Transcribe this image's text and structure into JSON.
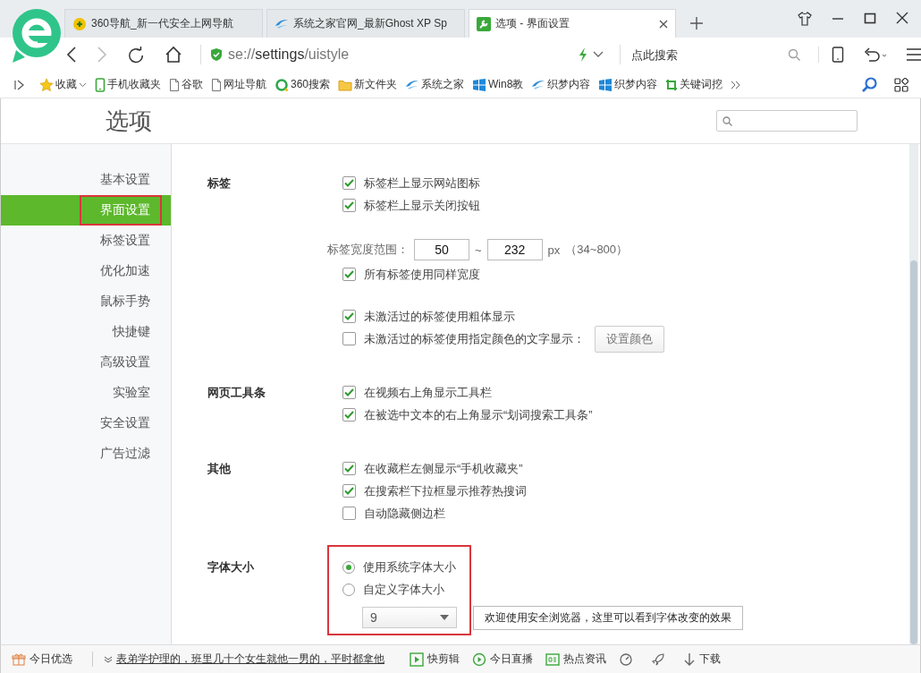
{
  "tabs": [
    {
      "label": "360导航_新一代安全上网导航",
      "kind": "badge",
      "selected": false
    },
    {
      "label": "系统之家官网_最新Ghost XP Sp",
      "kind": "site",
      "selected": false
    },
    {
      "label": "选项 - 界面设置",
      "kind": "wrench",
      "selected": true
    }
  ],
  "address": {
    "url": "se://**settings**/uistyle"
  },
  "search": {
    "placeholder": "点此搜索"
  },
  "bookmarks": [
    {
      "label": "收藏",
      "kind": "star"
    },
    {
      "label": "手机收藏夹",
      "kind": "phone"
    },
    {
      "label": "谷歌",
      "kind": "page"
    },
    {
      "label": "网址导航",
      "kind": "page"
    },
    {
      "label": "360搜索",
      "kind": "ring"
    },
    {
      "label": "新文件夹",
      "kind": "folder"
    },
    {
      "label": "系统之家",
      "kind": "site"
    },
    {
      "label": "Win8教",
      "kind": "windows"
    },
    {
      "label": "织梦内容",
      "kind": "site"
    },
    {
      "label": "织梦内容",
      "kind": "windows"
    },
    {
      "label": "关键词挖",
      "kind": "crop"
    }
  ],
  "page_title": "选项",
  "sidebar": {
    "items": [
      {
        "label": "基本设置",
        "selected": false,
        "highlighted": false
      },
      {
        "label": "界面设置",
        "selected": true,
        "highlighted": true
      },
      {
        "label": "标签设置",
        "selected": false,
        "highlighted": false
      },
      {
        "label": "优化加速",
        "selected": false,
        "highlighted": false
      },
      {
        "label": "鼠标手势",
        "selected": false,
        "highlighted": false
      },
      {
        "label": "快捷键",
        "selected": false,
        "highlighted": false
      },
      {
        "label": "高级设置",
        "selected": false,
        "highlighted": false
      },
      {
        "label": "实验室",
        "selected": false,
        "highlighted": false
      },
      {
        "label": "安全设置",
        "selected": false,
        "highlighted": false
      },
      {
        "label": "广告过滤",
        "selected": false,
        "highlighted": false
      }
    ]
  },
  "sections": [
    {
      "heading": "标签",
      "highlighted": false,
      "groups": [
        [
          {
            "kind": "checkbox",
            "label": "标签栏上显示网站图标",
            "checked": true
          },
          {
            "kind": "checkbox",
            "label": "标签栏上显示关闭按钮",
            "checked": true
          }
        ],
        [
          {
            "kind": "range",
            "label": "标签宽度范围：",
            "min": "50",
            "separator": "~",
            "max": "232",
            "unit": "px",
            "hint": "（34~800）"
          },
          {
            "kind": "checkbox",
            "label": "所有标签使用同样宽度",
            "checked": true
          }
        ],
        [
          {
            "kind": "checkbox",
            "label": "未激活过的标签使用粗体显示",
            "checked": true
          },
          {
            "kind": "checkbox",
            "label": "未激活过的标签使用指定颜色的文字显示：",
            "checked": false,
            "button": "设置颜色"
          }
        ]
      ]
    },
    {
      "heading": "网页工具条",
      "highlighted": false,
      "groups": [
        [
          {
            "kind": "checkbox",
            "label": "在视频右上角显示工具栏",
            "checked": true
          },
          {
            "kind": "checkbox",
            "label": "在被选中文本的右上角显示“划词搜索工具条”",
            "checked": true
          }
        ]
      ]
    },
    {
      "heading": "其他",
      "highlighted": false,
      "groups": [
        [
          {
            "kind": "checkbox",
            "label": "在收藏栏左侧显示“手机收藏夹”",
            "checked": true
          },
          {
            "kind": "checkbox",
            "label": "在搜索栏下拉框显示推荐热搜词",
            "checked": true
          },
          {
            "kind": "checkbox",
            "label": "自动隐藏侧边栏",
            "checked": false
          }
        ]
      ]
    },
    {
      "heading": "字体大小",
      "highlighted": true,
      "groups": [
        [
          {
            "kind": "radio",
            "label": "使用系统字体大小",
            "selected": true
          },
          {
            "kind": "radio",
            "label": "自定义字体大小",
            "selected": false
          },
          {
            "kind": "select",
            "value": "9",
            "preview": "欢迎使用安全浏览器，这里可以看到字体改变的效果"
          }
        ]
      ]
    }
  ],
  "status_bar": [
    {
      "kind": "gift",
      "label": "今日优选"
    },
    {
      "kind": "news",
      "label": "表弟学护理的，班里几十个女生就他一男的，平时都拿他"
    },
    {
      "kind": "play-box",
      "label": "快剪辑"
    },
    {
      "kind": "play-circle",
      "label": "今日直播"
    },
    {
      "kind": "news-box",
      "label": "热点资讯"
    },
    {
      "kind": "speed"
    },
    {
      "kind": "rocket"
    },
    {
      "kind": "download",
      "label": "下载"
    }
  ]
}
